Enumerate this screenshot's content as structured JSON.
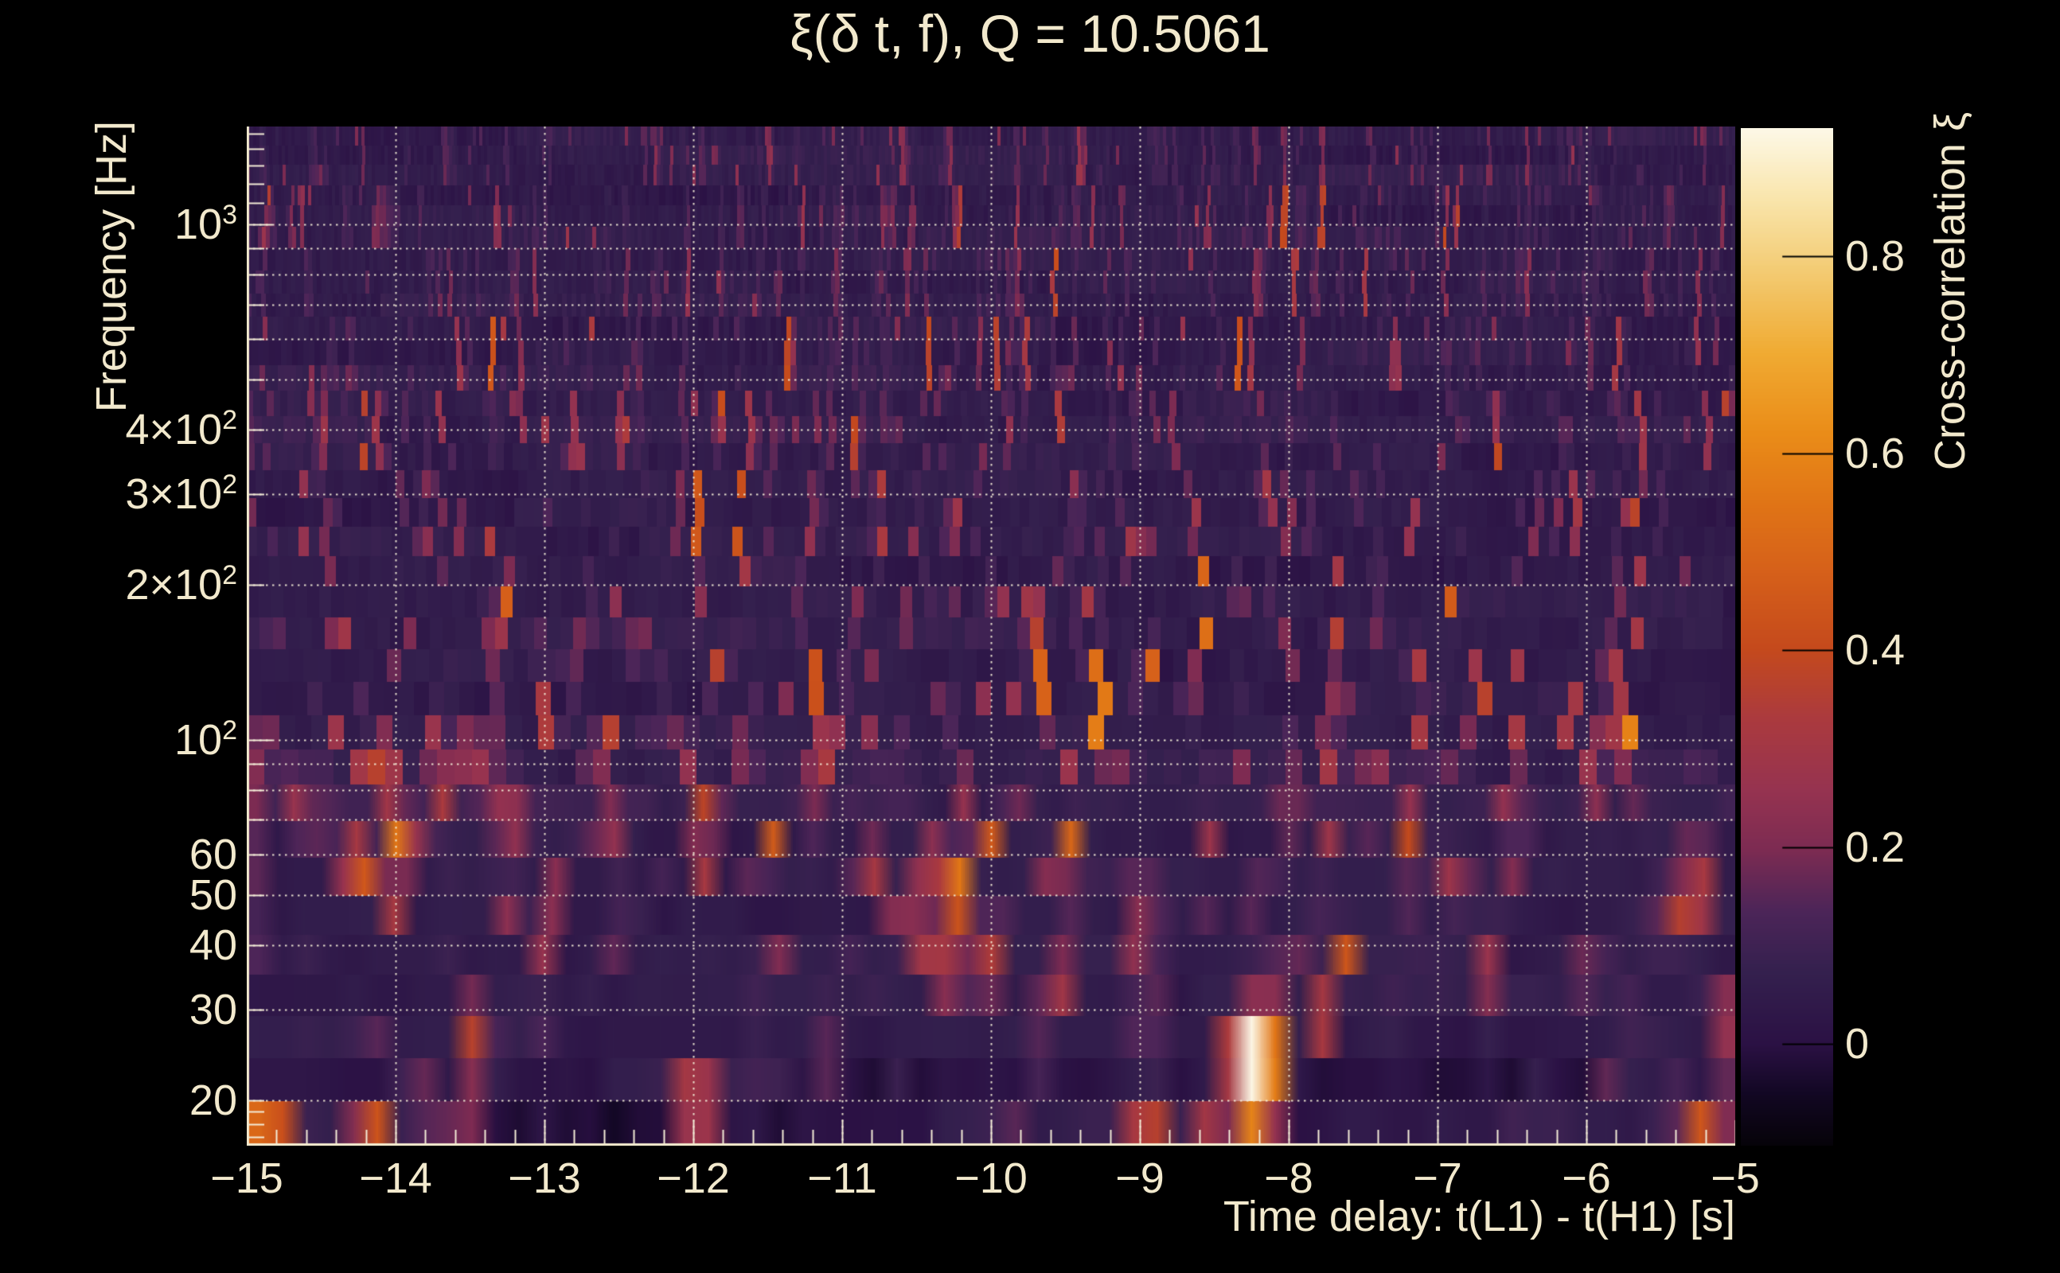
{
  "title": "ξ(δ t, f), Q = 10.5061",
  "colors": {
    "background": "#000000",
    "text": "#f2e9cd",
    "grid": "#f3ebd6",
    "axis": "#f2e9cd",
    "colorbar_tick": "#000000"
  },
  "chart_data": {
    "type": "heatmap",
    "title": "ξ(δ t, f), Q = 10.5061",
    "x": {
      "label": "Time delay: t(L1) - t(H1) [s]",
      "min": -15,
      "max": -5,
      "scale": "linear",
      "minor_tick_step": 0.2,
      "ticks": [
        {
          "v": -15,
          "label": "−15"
        },
        {
          "v": -14,
          "label": "−14"
        },
        {
          "v": -13,
          "label": "−13"
        },
        {
          "v": -12,
          "label": "−12"
        },
        {
          "v": -11,
          "label": "−11"
        },
        {
          "v": -10,
          "label": "−10"
        },
        {
          "v": -9,
          "label": "−9"
        },
        {
          "v": -8,
          "label": "−8"
        },
        {
          "v": -7,
          "label": "−7"
        },
        {
          "v": -6,
          "label": "−6"
        },
        {
          "v": -5,
          "label": "−5"
        }
      ],
      "gridlines": [
        -14,
        -13,
        -12,
        -11,
        -10,
        -9,
        -8,
        -7,
        -6
      ]
    },
    "y": {
      "label": "Frequency [Hz]",
      "min": 16.33,
      "max": 1549,
      "scale": "log",
      "ticks": [
        {
          "v": 1000,
          "base": "10",
          "exp": "3"
        },
        {
          "v": 400,
          "base": "4×10",
          "exp": "2"
        },
        {
          "v": 300,
          "base": "3×10",
          "exp": "2"
        },
        {
          "v": 200,
          "base": "2×10",
          "exp": "2"
        },
        {
          "v": 100,
          "base": "10",
          "exp": "2"
        },
        {
          "v": 60,
          "base": "60",
          "exp": ""
        },
        {
          "v": 50,
          "base": "50",
          "exp": ""
        },
        {
          "v": 40,
          "base": "40",
          "exp": ""
        },
        {
          "v": 30,
          "base": "30",
          "exp": ""
        },
        {
          "v": 20,
          "base": "20",
          "exp": ""
        }
      ],
      "gridlines": [
        20,
        30,
        40,
        50,
        60,
        70,
        80,
        90,
        100,
        200,
        300,
        400,
        500,
        600,
        700,
        800,
        900,
        1000
      ],
      "tick_marks": [
        17,
        18,
        19,
        20,
        30,
        40,
        50,
        60,
        70,
        80,
        90,
        100,
        200,
        300,
        400,
        500,
        600,
        700,
        800,
        900,
        1000,
        1100,
        1200,
        1300,
        1400,
        1500
      ]
    },
    "colorbar": {
      "label": "Cross-correlation ξ",
      "min": -0.103,
      "max": 0.93,
      "ticks": [
        {
          "v": 0.8,
          "label": "0.8"
        },
        {
          "v": 0.6,
          "label": "0.6"
        },
        {
          "v": 0.4,
          "label": "0.4"
        },
        {
          "v": 0.2,
          "label": "0.2"
        },
        {
          "v": 0,
          "label": "0"
        }
      ]
    },
    "colormap": {
      "name": "inferno-like",
      "stops": [
        [
          0.0,
          "#060309"
        ],
        [
          0.05,
          "#120723"
        ],
        [
          0.1,
          "#2b1144"
        ],
        [
          0.17,
          "#34204e"
        ],
        [
          0.23,
          "#4c2558"
        ],
        [
          0.29,
          "#7c2b52"
        ],
        [
          0.35,
          "#963350"
        ],
        [
          0.42,
          "#ab3a3e"
        ],
        [
          0.49,
          "#c54a1c"
        ],
        [
          0.56,
          "#d55f1a"
        ],
        [
          0.63,
          "#e07416"
        ],
        [
          0.7,
          "#ea8c18"
        ],
        [
          0.78,
          "#f0ab33"
        ],
        [
          0.86,
          "#f3cb73"
        ],
        [
          0.93,
          "#f9e5ab"
        ],
        [
          1.0,
          "#fdf8e7"
        ]
      ]
    },
    "texture": {
      "seed": 7,
      "rows": 34,
      "row_ratio": 1.026,
      "background_xi": 0.058,
      "band_scale": [
        0.85,
        0.9,
        0.95,
        1.0,
        1.05,
        1.15,
        1.3,
        1.35,
        1.25,
        0.9,
        0.55,
        0.35
      ]
    },
    "hotspots": [
      {
        "t": -14.97,
        "f1": 60,
        "f2": 100,
        "xi": 0.3,
        "w": 0.03
      },
      {
        "t": -14.88,
        "f1": 16.33,
        "f2": 19,
        "xi": 0.55,
        "w": 0.12
      },
      {
        "t": -14.7,
        "f1": 60,
        "f2": 80,
        "xi": 0.3,
        "w": 0.03
      },
      {
        "t": -14.5,
        "f1": 66,
        "f2": 82,
        "xi": 0.3,
        "w": 0.03
      },
      {
        "t": -14.3,
        "f1": 51,
        "f2": 61,
        "xi": 0.35,
        "w": 0.03
      },
      {
        "t": -14.15,
        "f1": 16.33,
        "f2": 18.5,
        "xi": 0.5,
        "w": 0.08
      },
      {
        "t": -14.08,
        "f1": 80,
        "f2": 100,
        "xi": 0.35,
        "w": 0.03
      },
      {
        "t": -14.0,
        "f1": 46,
        "f2": 72,
        "xi": 0.58,
        "w": 0.035
      },
      {
        "t": -13.7,
        "f1": 70,
        "f2": 110,
        "xi": 0.5,
        "w": 0.03
      },
      {
        "t": -13.55,
        "f1": 16.33,
        "f2": 18,
        "xi": 0.42,
        "w": 0.07
      },
      {
        "t": -13.48,
        "f1": 80,
        "f2": 100,
        "xi": 0.45,
        "w": 0.03
      },
      {
        "t": -13.35,
        "f1": 145,
        "f2": 175,
        "xi": 0.3,
        "w": 0.025
      },
      {
        "t": -13.28,
        "f1": 44,
        "f2": 50,
        "xi": 0.45,
        "w": 0.035
      },
      {
        "t": -13.25,
        "f1": 59,
        "f2": 75,
        "xi": 0.35,
        "w": 0.03
      },
      {
        "t": -13.03,
        "f1": 35,
        "f2": 42,
        "xi": 0.45,
        "w": 0.04
      },
      {
        "t": -12.55,
        "f1": 95,
        "f2": 110,
        "xi": 0.3,
        "w": 0.025
      },
      {
        "t": -12.35,
        "f1": 140,
        "f2": 160,
        "xi": 0.28,
        "w": 0.025
      },
      {
        "t": -12.05,
        "f1": 90,
        "f2": 100,
        "xi": 0.3,
        "w": 0.025
      },
      {
        "t": -11.95,
        "f1": 16.33,
        "f2": 21,
        "xi": 0.52,
        "w": 0.09
      },
      {
        "t": -11.92,
        "f1": 51,
        "f2": 73,
        "xi": 0.55,
        "w": 0.035
      },
      {
        "t": -11.65,
        "f1": 88,
        "f2": 100,
        "xi": 0.32,
        "w": 0.025
      },
      {
        "t": -11.3,
        "f1": 180,
        "f2": 210,
        "xi": 0.25,
        "w": 0.02
      },
      {
        "t": -11.1,
        "f1": 21,
        "f2": 25,
        "xi": 0.33,
        "w": 0.05
      },
      {
        "t": -11.08,
        "f1": 88,
        "f2": 102,
        "xi": 0.45,
        "w": 0.03
      },
      {
        "t": -10.8,
        "f1": 57,
        "f2": 67,
        "xi": 0.35,
        "w": 0.03
      },
      {
        "t": -10.45,
        "f1": 37,
        "f2": 52,
        "xi": 0.55,
        "w": 0.035
      },
      {
        "t": -10.32,
        "f1": 52,
        "f2": 64,
        "xi": 0.45,
        "w": 0.03
      },
      {
        "t": -10.2,
        "f1": 33,
        "f2": 55,
        "xi": 0.6,
        "w": 0.04
      },
      {
        "t": -9.93,
        "f1": 34,
        "f2": 42,
        "xi": 0.55,
        "w": 0.045
      },
      {
        "t": -9.62,
        "f1": 52,
        "f2": 60,
        "xi": 0.32,
        "w": 0.03
      },
      {
        "t": -9.48,
        "f1": 30,
        "f2": 36,
        "xi": 0.5,
        "w": 0.045
      },
      {
        "t": -9.4,
        "f1": 84,
        "f2": 94,
        "xi": 0.4,
        "w": 0.025
      },
      {
        "t": -9.0,
        "f1": 125,
        "f2": 140,
        "xi": 0.3,
        "w": 0.02
      },
      {
        "t": -8.92,
        "f1": 37,
        "f2": 47,
        "xi": 0.5,
        "w": 0.035
      },
      {
        "t": -8.9,
        "f1": 16.33,
        "f2": 19,
        "xi": 0.55,
        "w": 0.1
      },
      {
        "t": -8.5,
        "f1": 16.33,
        "f2": 18,
        "xi": 0.45,
        "w": 0.07
      },
      {
        "t": -8.27,
        "f1": 19,
        "f2": 29,
        "xi": 0.6,
        "w": 0.05
      },
      {
        "t": -8.17,
        "f1": 20,
        "f2": 29,
        "xi": 0.95,
        "w": 0.055
      },
      {
        "t": -8.13,
        "f1": 16.33,
        "f2": 19.5,
        "xi": 0.62,
        "w": 0.08
      },
      {
        "t": -8.08,
        "f1": 20,
        "f2": 26,
        "xi": 0.55,
        "w": 0.05
      },
      {
        "t": -7.7,
        "f1": 27,
        "f2": 31,
        "xi": 0.55,
        "w": 0.04
      },
      {
        "t": -7.14,
        "f1": 57,
        "f2": 72,
        "xi": 0.5,
        "w": 0.03
      },
      {
        "t": -6.7,
        "f1": 97,
        "f2": 112,
        "xi": 0.3,
        "w": 0.025
      },
      {
        "t": -6.6,
        "f1": 34,
        "f2": 38,
        "xi": 0.45,
        "w": 0.04
      },
      {
        "t": -5.9,
        "f1": 34,
        "f2": 40,
        "xi": 0.3,
        "w": 0.04
      },
      {
        "t": -5.88,
        "f1": 70,
        "f2": 97,
        "xi": 0.33,
        "w": 0.03
      },
      {
        "t": -5.2,
        "f1": 46,
        "f2": 62,
        "xi": 0.5,
        "w": 0.03
      },
      {
        "t": -5.12,
        "f1": 16.33,
        "f2": 18.5,
        "xi": 0.5,
        "w": 0.08
      }
    ]
  }
}
